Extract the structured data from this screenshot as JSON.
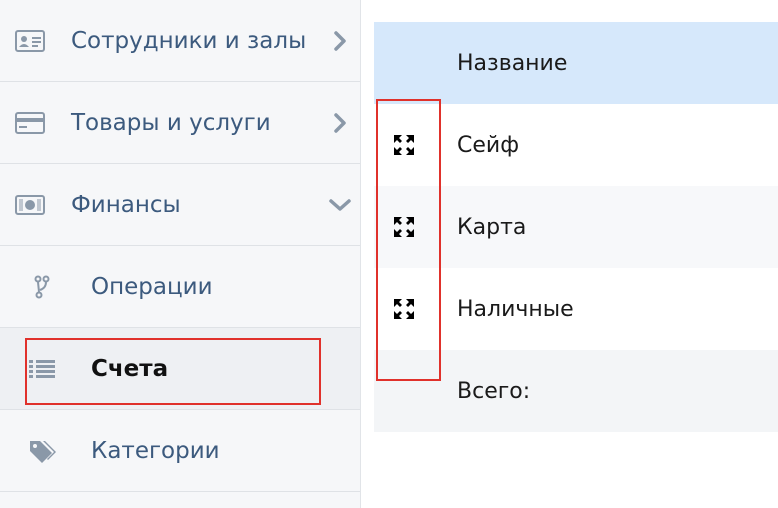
{
  "sidebar": {
    "items": [
      {
        "label": "Сотрудники и залы",
        "icon": "id-card-icon",
        "chevron": "chevron-right-icon"
      },
      {
        "label": "Товары и услуги",
        "icon": "credit-card-icon",
        "chevron": "chevron-right-icon"
      },
      {
        "label": "Финансы",
        "icon": "banknote-icon",
        "chevron": "chevron-down-icon"
      },
      {
        "label": "Операции",
        "icon": "branch-icon"
      },
      {
        "label": "Счета",
        "icon": "list-icon",
        "active": true
      },
      {
        "label": "Категории",
        "icon": "tags-icon"
      }
    ]
  },
  "table": {
    "header": "Название",
    "rows": [
      {
        "name": "Сейф",
        "icon": "move-icon"
      },
      {
        "name": "Карта",
        "icon": "move-icon"
      },
      {
        "name": "Наличные",
        "icon": "move-icon"
      }
    ],
    "total_label": "Всего:"
  },
  "colors": {
    "sidebar_text": "#3c5a7e",
    "header_bg": "#d6e8fb",
    "highlight": "#e0312b",
    "icon_gray": "#8a98a8"
  }
}
